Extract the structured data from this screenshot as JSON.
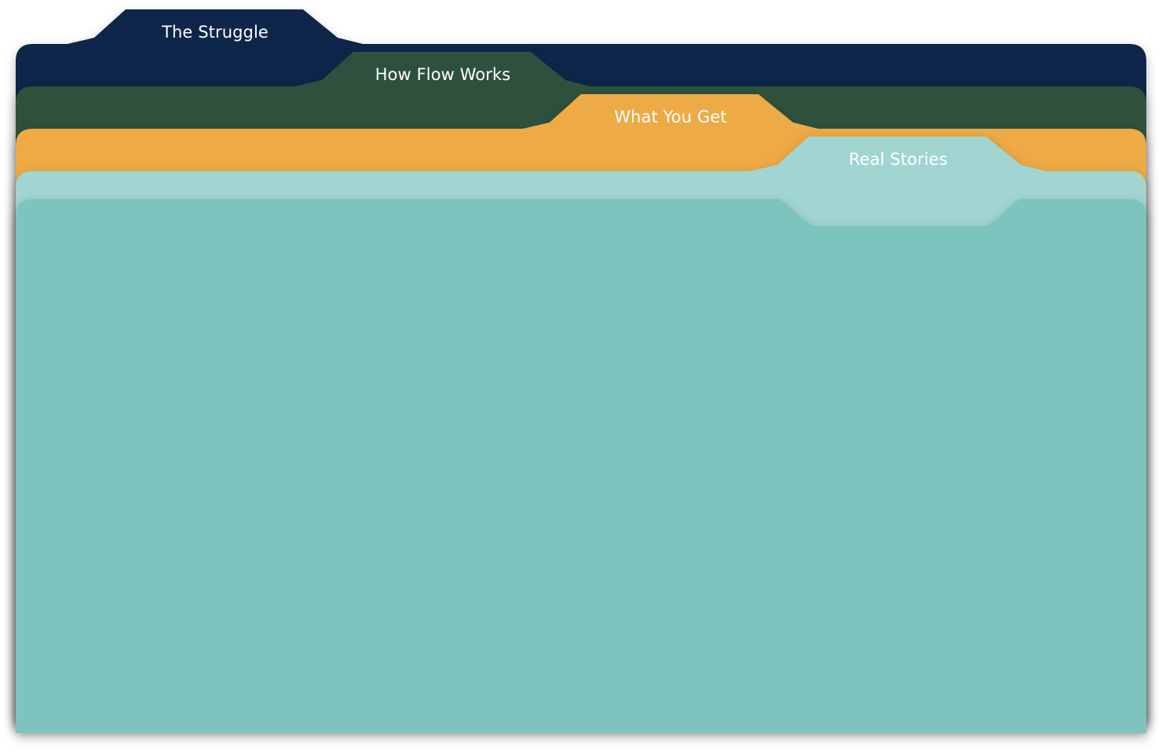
{
  "tabs": [
    {
      "label": "The Struggle",
      "color": "#0f2549"
    },
    {
      "label": "How Flow Works",
      "color": "#2e513d"
    },
    {
      "label": "What You Get",
      "color": "#edaa45"
    },
    {
      "label": "Real Stories",
      "color": "#a0d5d1"
    }
  ],
  "content_panel": {
    "color": "#7bc4bd"
  }
}
